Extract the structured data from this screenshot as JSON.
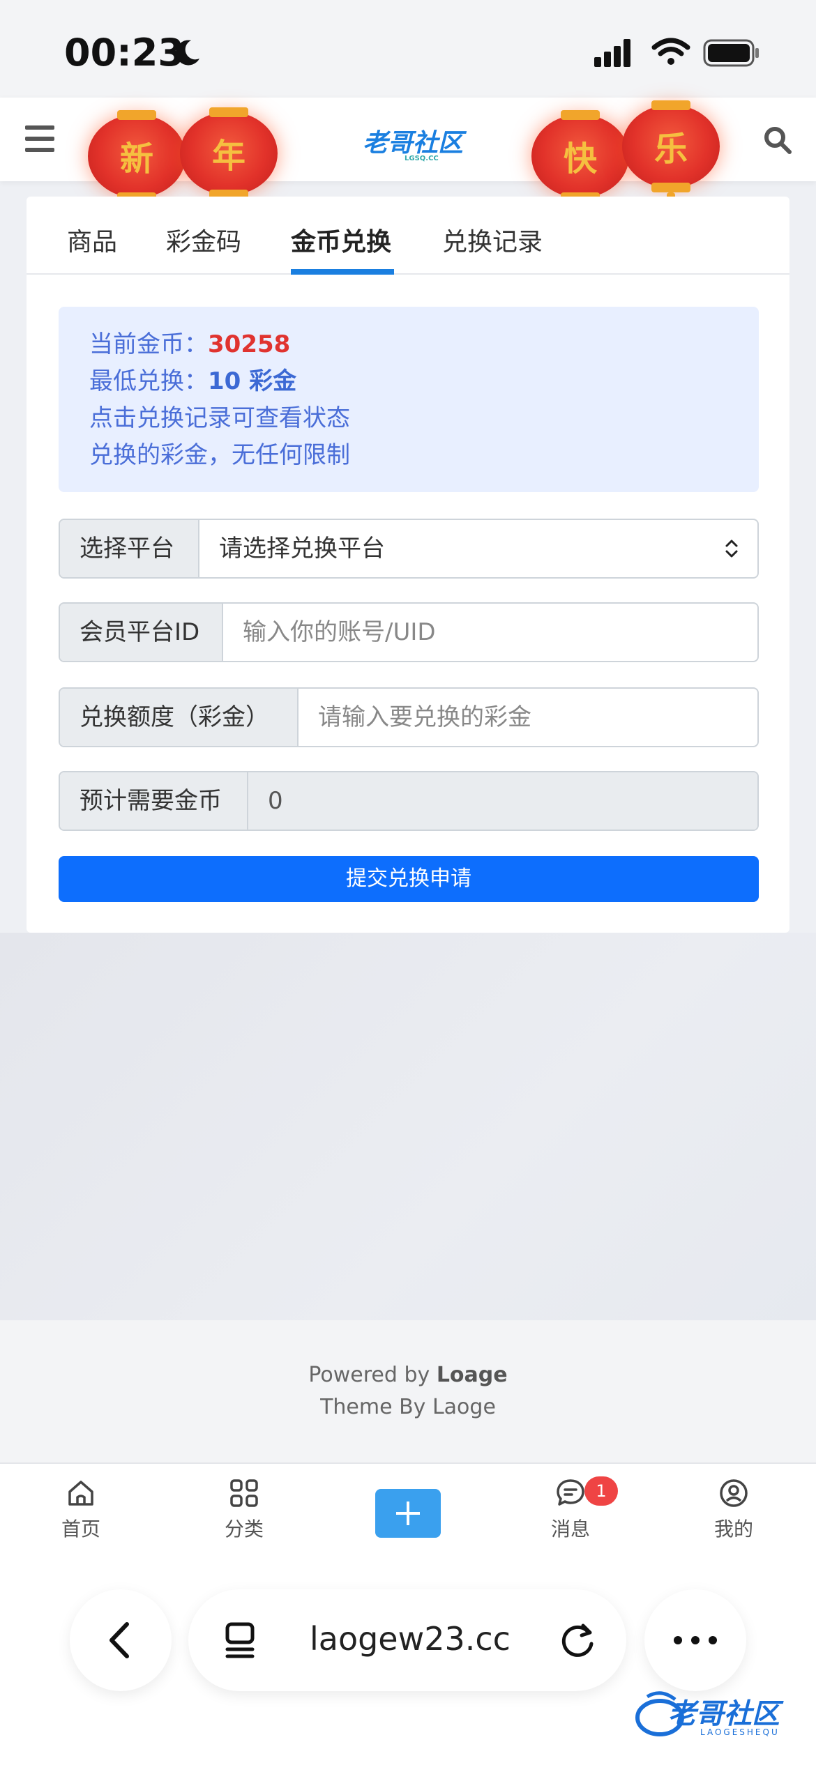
{
  "status_bar": {
    "time": "00:23"
  },
  "header": {
    "logo_text": "老哥社区",
    "logo_sub": "LGSQ.CC"
  },
  "lanterns": [
    "新",
    "年",
    "快",
    "乐"
  ],
  "tabs": [
    {
      "label": "商品"
    },
    {
      "label": "彩金码"
    },
    {
      "label": "金币兑换",
      "active": true
    },
    {
      "label": "兑换记录"
    }
  ],
  "info": {
    "coins_label": "当前金币：",
    "coins_value": "30258",
    "min_label": "最低兑换：",
    "min_value": "10 彩金",
    "line3": "点击兑换记录可查看状态",
    "line4": "兑换的彩金，无任何限制"
  },
  "form": {
    "platform_label": "选择平台",
    "platform_value": "请选择兑换平台",
    "member_label": "会员平台ID",
    "member_placeholder": "输入你的账号/UID",
    "amount_label": "兑换额度（彩金）",
    "amount_placeholder": "请输入要兑换的彩金",
    "estimate_label": "预计需要金币",
    "estimate_value": "0",
    "submit_label": "提交兑换申请"
  },
  "footer": {
    "powered_prefix": "Powered by ",
    "powered_name": "Loage",
    "theme": "Theme By Laoge"
  },
  "tabbar": {
    "home": "首页",
    "category": "分类",
    "messages": "消息",
    "messages_badge": "1",
    "mine": "我的"
  },
  "browser": {
    "url": "laogew23.cc"
  },
  "watermark": {
    "text": "老哥社区",
    "sub": "LAOGESHEQU"
  },
  "colors": {
    "accent": "#0d6efd",
    "coin_red": "#e0332f",
    "info_bg": "#e8efff",
    "lantern": "#e2322a"
  }
}
